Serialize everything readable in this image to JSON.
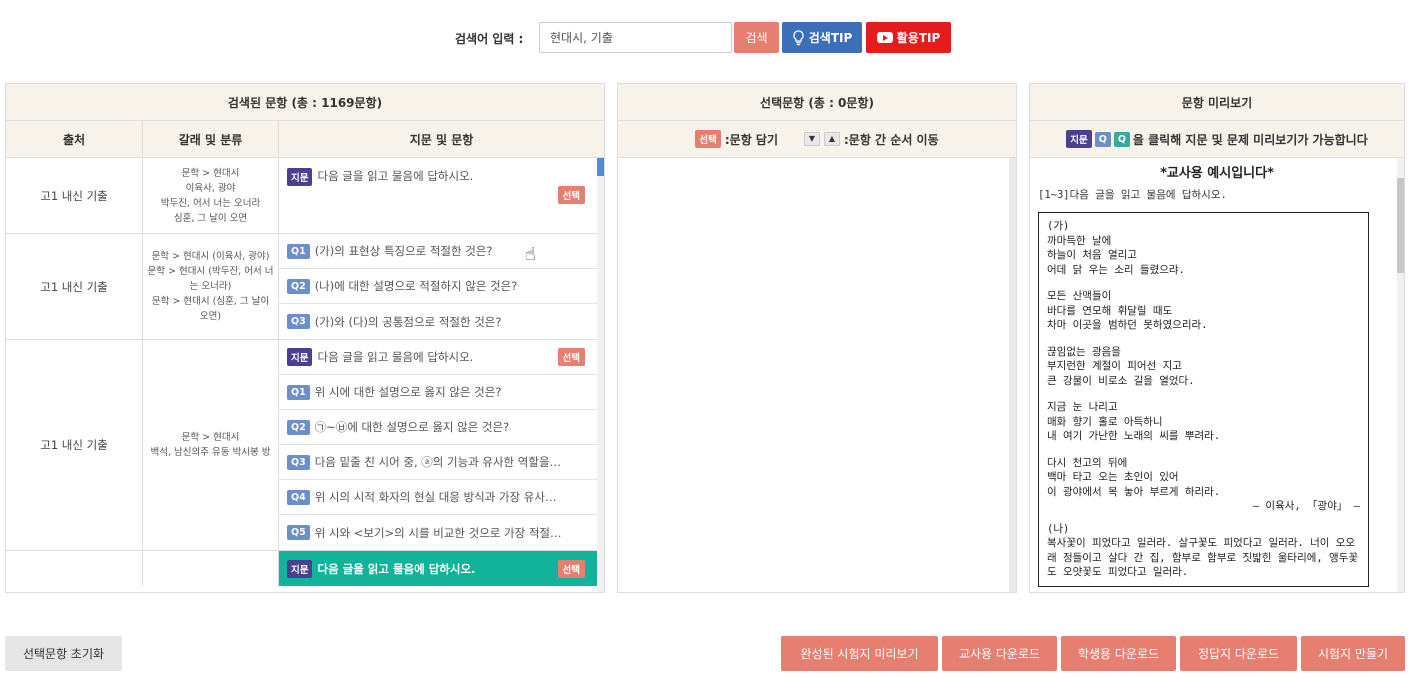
{
  "search": {
    "label": "검색어 입력 :",
    "value": "현대시, 기출",
    "search_btn": "검색",
    "tip_btn": "검색TIP",
    "use_btn": "활용TIP"
  },
  "left_panel": {
    "title": "검색된 문항 (총 : 1169문항)",
    "col_source": "출처",
    "col_genre": "갈래 및 분류",
    "col_items": "지문 및 문항",
    "select_label": "선택",
    "tag_passage": "지문",
    "groups": [
      {
        "source": "고1 내신 기출",
        "genre": [
          "문학 > 현대시",
          "이육사, 광야",
          "박두진, 어서 너는 오너라",
          "심훈, 그 날이 오면"
        ],
        "items": [
          {
            "tag": "지문",
            "text": "다음 글을 읽고 물음에 답하시오."
          }
        ]
      },
      {
        "source": "고1 내신 기출",
        "genre": [
          "문학 > 현대시 (이육사, 광야)",
          "문학 > 현대시 (박두진, 어서 너는 오너라)",
          "문학 > 현대시 (심훈, 그 날이 오면)"
        ],
        "items": [
          {
            "tag": "Q1",
            "text": "(가)의 표현상 특징으로 적절한 것은?"
          },
          {
            "tag": "Q2",
            "text": "(나)에 대한 설명으로 적절하지 않은 것은?"
          },
          {
            "tag": "Q3",
            "text": "(가)와 (다)의 공통점으로 적절한 것은?"
          }
        ]
      },
      {
        "source": "고1 내신 기출",
        "genre": [
          "문학 > 현대시",
          "백석, 남신의주 유동 박시봉 방"
        ],
        "items": [
          {
            "tag": "지문",
            "text": "다음 글을 읽고 물음에 답하시오."
          },
          {
            "tag": "Q1",
            "text": "위 시에 대한 설명으로 옳지 않은 것은?"
          },
          {
            "tag": "Q2",
            "text": "㉠~㉥에 대한 설명으로 옳지 않은 것은?"
          },
          {
            "tag": "Q3",
            "text": "다음 밑줄 친 시어 중, ⓐ의 기능과 유사한 역할을…"
          },
          {
            "tag": "Q4",
            "text": "위 시의 시적 화자의 현실 대응 방식과 가장 유사…"
          },
          {
            "tag": "Q5",
            "text": "위 시와 <보기>의 시를 비교한 것으로 가장 적절…"
          }
        ]
      },
      {
        "source": "",
        "genre": [],
        "items": [
          {
            "tag": "지문",
            "text": "다음 글을 읽고 물음에 답하시오."
          }
        ]
      }
    ]
  },
  "mid_panel": {
    "title": "선택문항 (총 : 0문항)",
    "select_tag": "선택",
    "hint_add": ":문항 담기",
    "arrow_down": "▼",
    "arrow_up": "▲",
    "hint_move": ":문항 간 순서 이동"
  },
  "right_panel": {
    "title": "문항 미리보기",
    "tag_passage": "지문",
    "tag_q1": "Q",
    "tag_q2": "Q",
    "hint": "을 클릭해 지문 및 문제 미리보기가 가능합니다",
    "preview_title": "*교사용 예시입니다*",
    "intro": "[1~3]다음 글을 읽고 물음에 답하시오.",
    "ga_label": "(가)",
    "stanzas": [
      [
        "까마득한 날에",
        "하늘이 처음 열리고",
        "어데 닭 우는 소리 들렸으랴."
      ],
      [
        "모든 산맥들이",
        "바다를 연모해 휘달릴 때도",
        "차마 이곳을 범하던 못하였으리라."
      ],
      [
        "끊임없는 광음을",
        "부지런한 계절이 피어선 지고",
        "큰 강물이 비로소 길을 열었다."
      ],
      [
        "지금 눈 나리고",
        "매화 향기 홀로 아득하니",
        "내 여기 가난한 노래의 씨를 뿌려라."
      ],
      [
        "다시 천고의 뒤에",
        "백마 타고 오는 초인이 있어",
        "이 광야에서 목 놓아 부르게 하리라."
      ]
    ],
    "author": "– 이육사, 「광야」 –",
    "na_label": "(나)",
    "prose": "복사꽃이 피었다고 일러라. 살구꽃도 피었다고 일러라. 너이 오오래 정들이고 살다 간 집, 함부로 함부로 짓밟힌 울타리에, 앵두꽃도 오얏꽃도 피었다고 일러라."
  },
  "bottom": {
    "reset": "선택문항 초기화",
    "preview_exam": "완성된 시험지 미리보기",
    "teacher_dl": "교사용 다운로드",
    "student_dl": "학생용 다운로드",
    "answer_dl": "정답지 다운로드",
    "make_exam": "시험지 만들기"
  }
}
